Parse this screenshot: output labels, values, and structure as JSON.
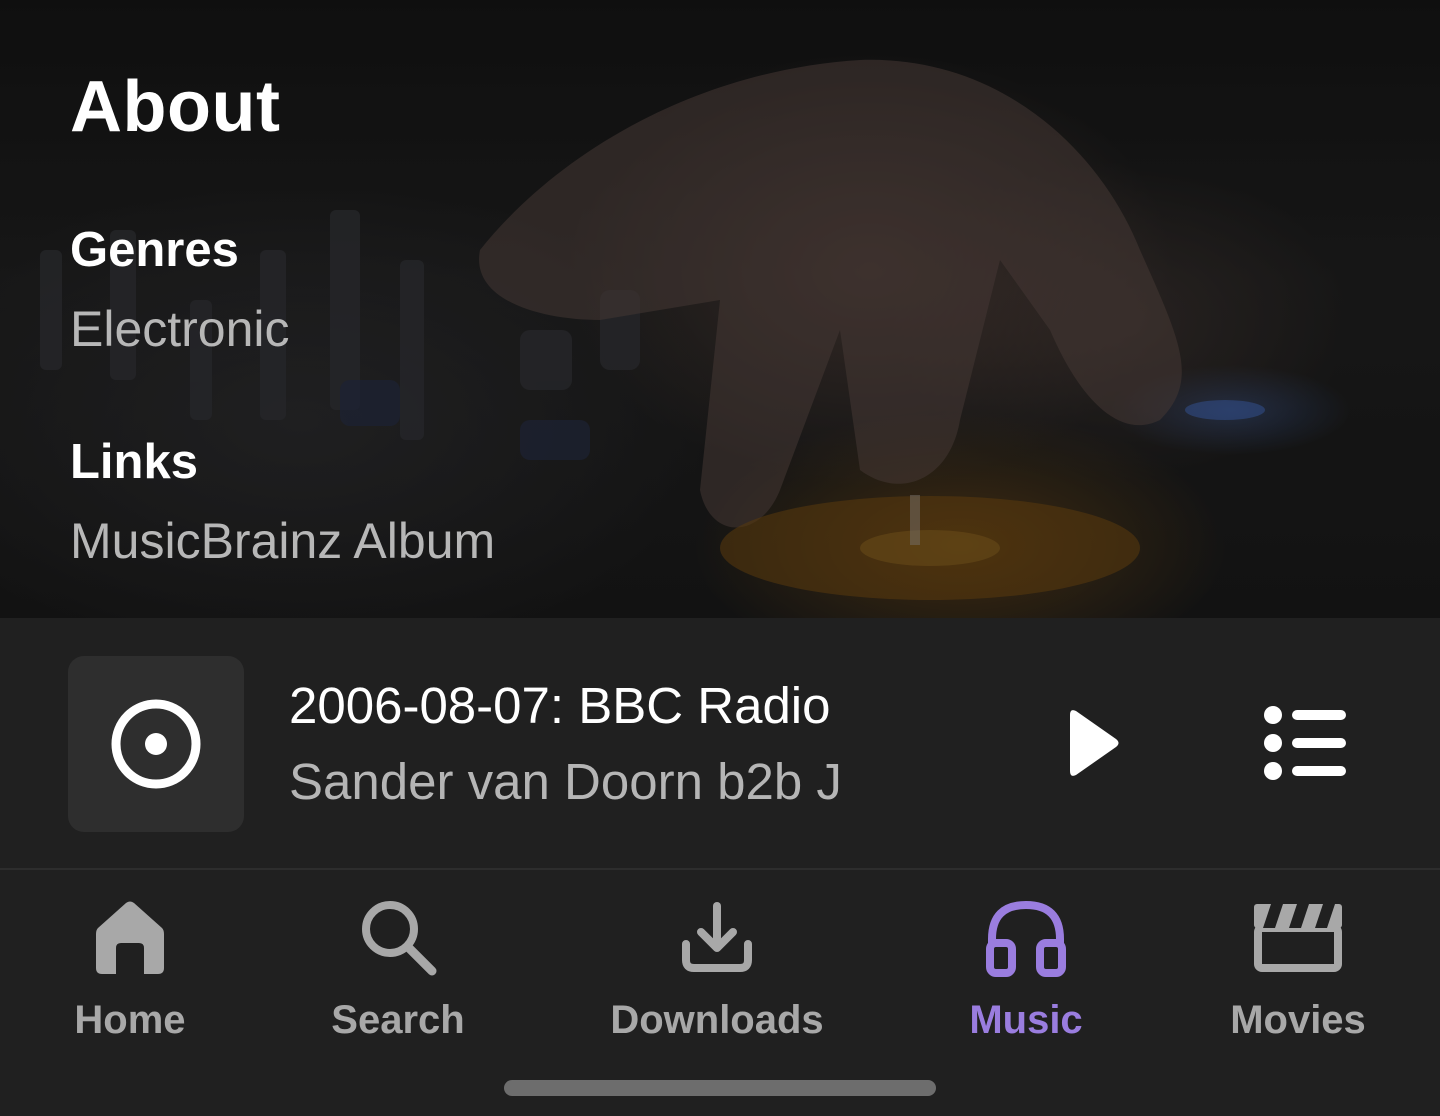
{
  "about": {
    "title": "About",
    "genres_label": "Genres",
    "genres_value": "Electronic",
    "links_label": "Links",
    "links_value": "MusicBrainz Album"
  },
  "now_playing": {
    "title": "2006-08-07: BBC Radio",
    "artist": "Sander van Doorn b2b J",
    "cover_icon": "disc-icon",
    "play_icon": "play-icon",
    "queue_icon": "queue-list-icon"
  },
  "tabs": [
    {
      "label": "Home",
      "icon": "home-icon",
      "active": false
    },
    {
      "label": "Search",
      "icon": "search-icon",
      "active": false
    },
    {
      "label": "Downloads",
      "icon": "download-icon",
      "active": false
    },
    {
      "label": "Music",
      "icon": "headphones-icon",
      "active": true
    },
    {
      "label": "Movies",
      "icon": "clapperboard-icon",
      "active": false
    }
  ],
  "colors": {
    "accent": "#9a7ddf",
    "background": "#202020",
    "inactive": "#a8a8a8",
    "secondary_text": "#b5b5b5"
  }
}
